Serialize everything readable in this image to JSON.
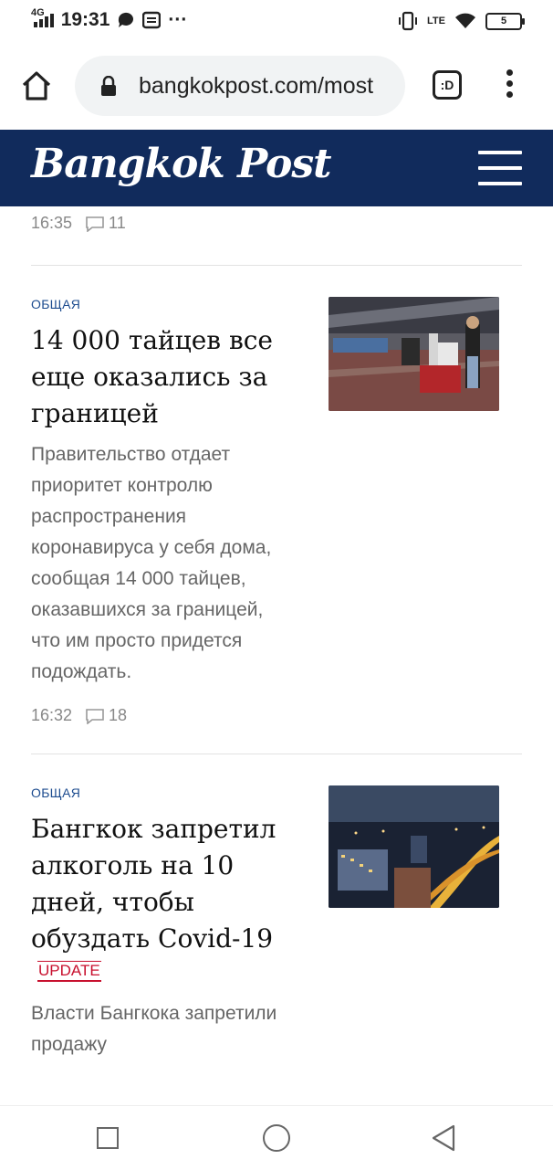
{
  "status_bar": {
    "network": "4G",
    "time": "19:31",
    "dots": "···",
    "lte": "LTE",
    "battery": "5"
  },
  "browser": {
    "url": "bangkokpost.com/most",
    "tab_label": ":D"
  },
  "site": {
    "logo": "Bangkok Post"
  },
  "articles": [
    {
      "time": "16:35",
      "comments": "11"
    },
    {
      "category": "ОБЩАЯ",
      "title": "14 000 тайцев все еще оказались за границей",
      "summary": "Правительство отдает приоритет контролю распространения коронавируса у себя дома, сообщая 14 000 тайцев, оказавшихся за границей, что им просто придется подождать.",
      "time": "16:32",
      "comments": "18"
    },
    {
      "category": "ОБЩАЯ",
      "title": "Бангкок запретил алкоголь на 10 дней, чтобы обуздать Covid-19",
      "badge": "UPDATE",
      "summary": "Власти Бангкока запретили продажу"
    }
  ],
  "colors": {
    "brand_navy": "#112b5c",
    "category_blue": "#1d4c8f",
    "update_red": "#c8102e"
  }
}
